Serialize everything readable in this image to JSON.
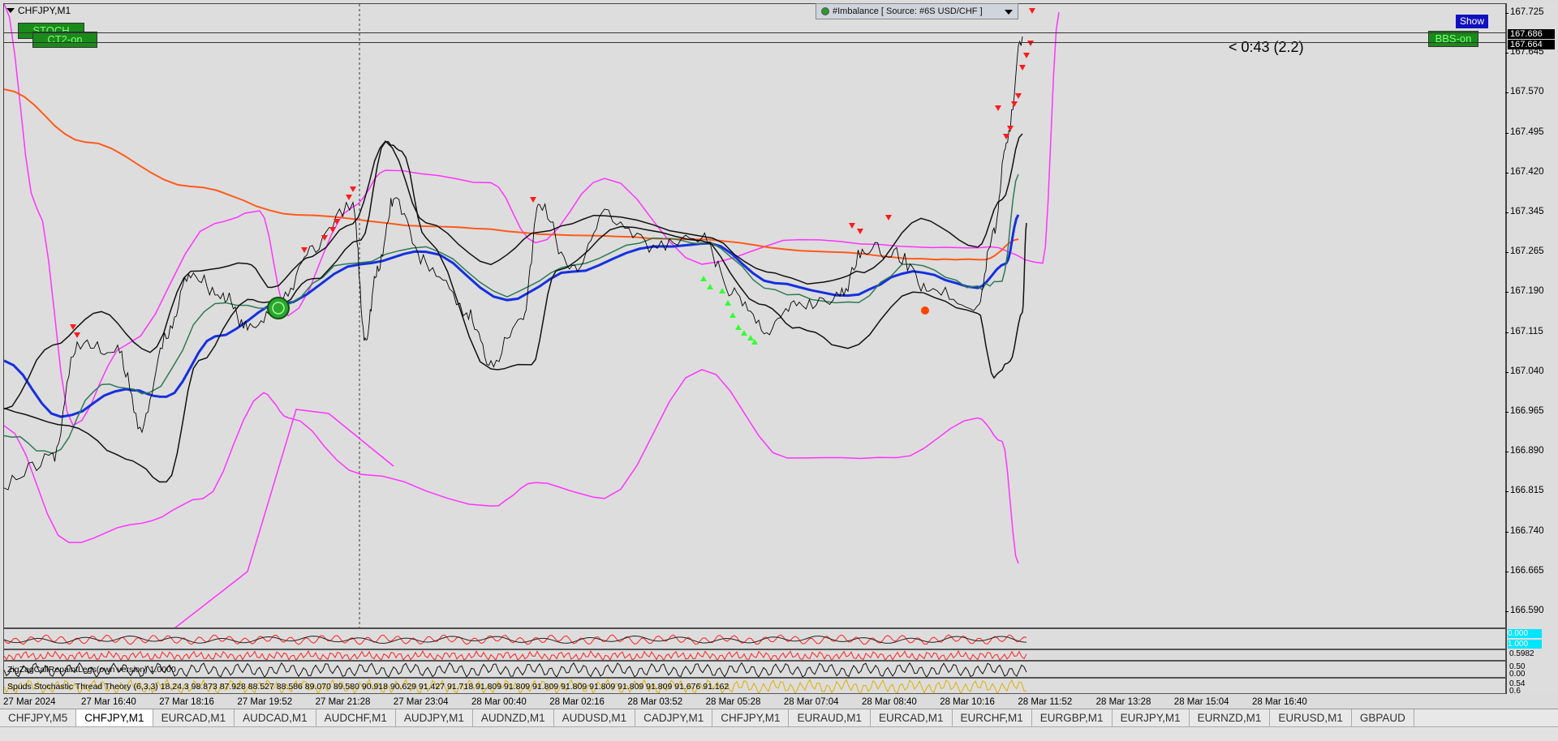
{
  "chart": {
    "title": "CHFJPY,M1",
    "buttons": {
      "stoch": "STOCH",
      "ct2": "CT2-on",
      "bbs": "BBS-on",
      "show": "Show"
    },
    "imbalance_label": "#Imbalance [ Source: #6S USD/CHF ]",
    "timer": "< 0:43 (2.2)"
  },
  "price_axis": {
    "ticks": [
      "167.725",
      "167.645",
      "167.570",
      "167.495",
      "167.420",
      "167.345",
      "167.265",
      "167.190",
      "167.115",
      "167.040",
      "166.965",
      "166.890",
      "166.815",
      "166.740",
      "166.665",
      "166.590"
    ],
    "flags": [
      "167.686",
      "167.664"
    ]
  },
  "time_axis": {
    "ticks": [
      "27 Mar 2024",
      "27 Mar 16:40",
      "27 Mar 18:16",
      "27 Mar 19:52",
      "27 Mar 21:28",
      "27 Mar 23:04",
      "28 Mar 00:40",
      "28 Mar 02:16",
      "28 Mar 03:52",
      "28 Mar 05:28",
      "28 Mar 07:04",
      "28 Mar 08:40",
      "28 Mar 10:16",
      "28 Mar 11:52",
      "28 Mar 13:28",
      "28 Mar 15:04",
      "28 Mar 16:40"
    ]
  },
  "subwindows": {
    "zigzag_label": "ZigZagCallRepaintLegs(own version) 1.0000",
    "stoch_label": "Spuds Stochastic Thread Theory (6,3,3) 18.24.3 98.873 87.928 88.527 88.586 89.070 89.580 90.918 90.629 91.427 91.718 91.809 91.809 91.809 91.809 91.809 91.809 91.809 91.676 91.162",
    "flag_values": [
      "0.000",
      "1.000"
    ],
    "scale_values": [
      "0.5982",
      "0.50",
      "0.00"
    ],
    "lower_scale": [
      "0.54",
      "0.6"
    ]
  },
  "tabs": [
    "CHFJPY,M5",
    "CHFJPY,M1",
    "EURCAD,M1",
    "AUDCAD,M1",
    "AUDCHF,M1",
    "AUDJPY,M1",
    "AUDNZD,M1",
    "AUDUSD,M1",
    "CADJPY,M1",
    "CHFJPY,M1",
    "EURAUD,M1",
    "EURCAD,M1",
    "EURCHF,M1",
    "EURGBP,M1",
    "EURJPY,M1",
    "EURNZD,M1",
    "EURUSD,M1",
    "GBPAUD"
  ],
  "active_tab_index": 1,
  "colors": {
    "background": "#dddddd",
    "upper_band": "#ff33ff",
    "ma_blue": "#1530e0",
    "ma_orange": "#ff5a1a",
    "ma_green": "#2f7a55",
    "sell_arrow": "#ff1a1a",
    "buy_arrow": "#33ff33"
  }
}
